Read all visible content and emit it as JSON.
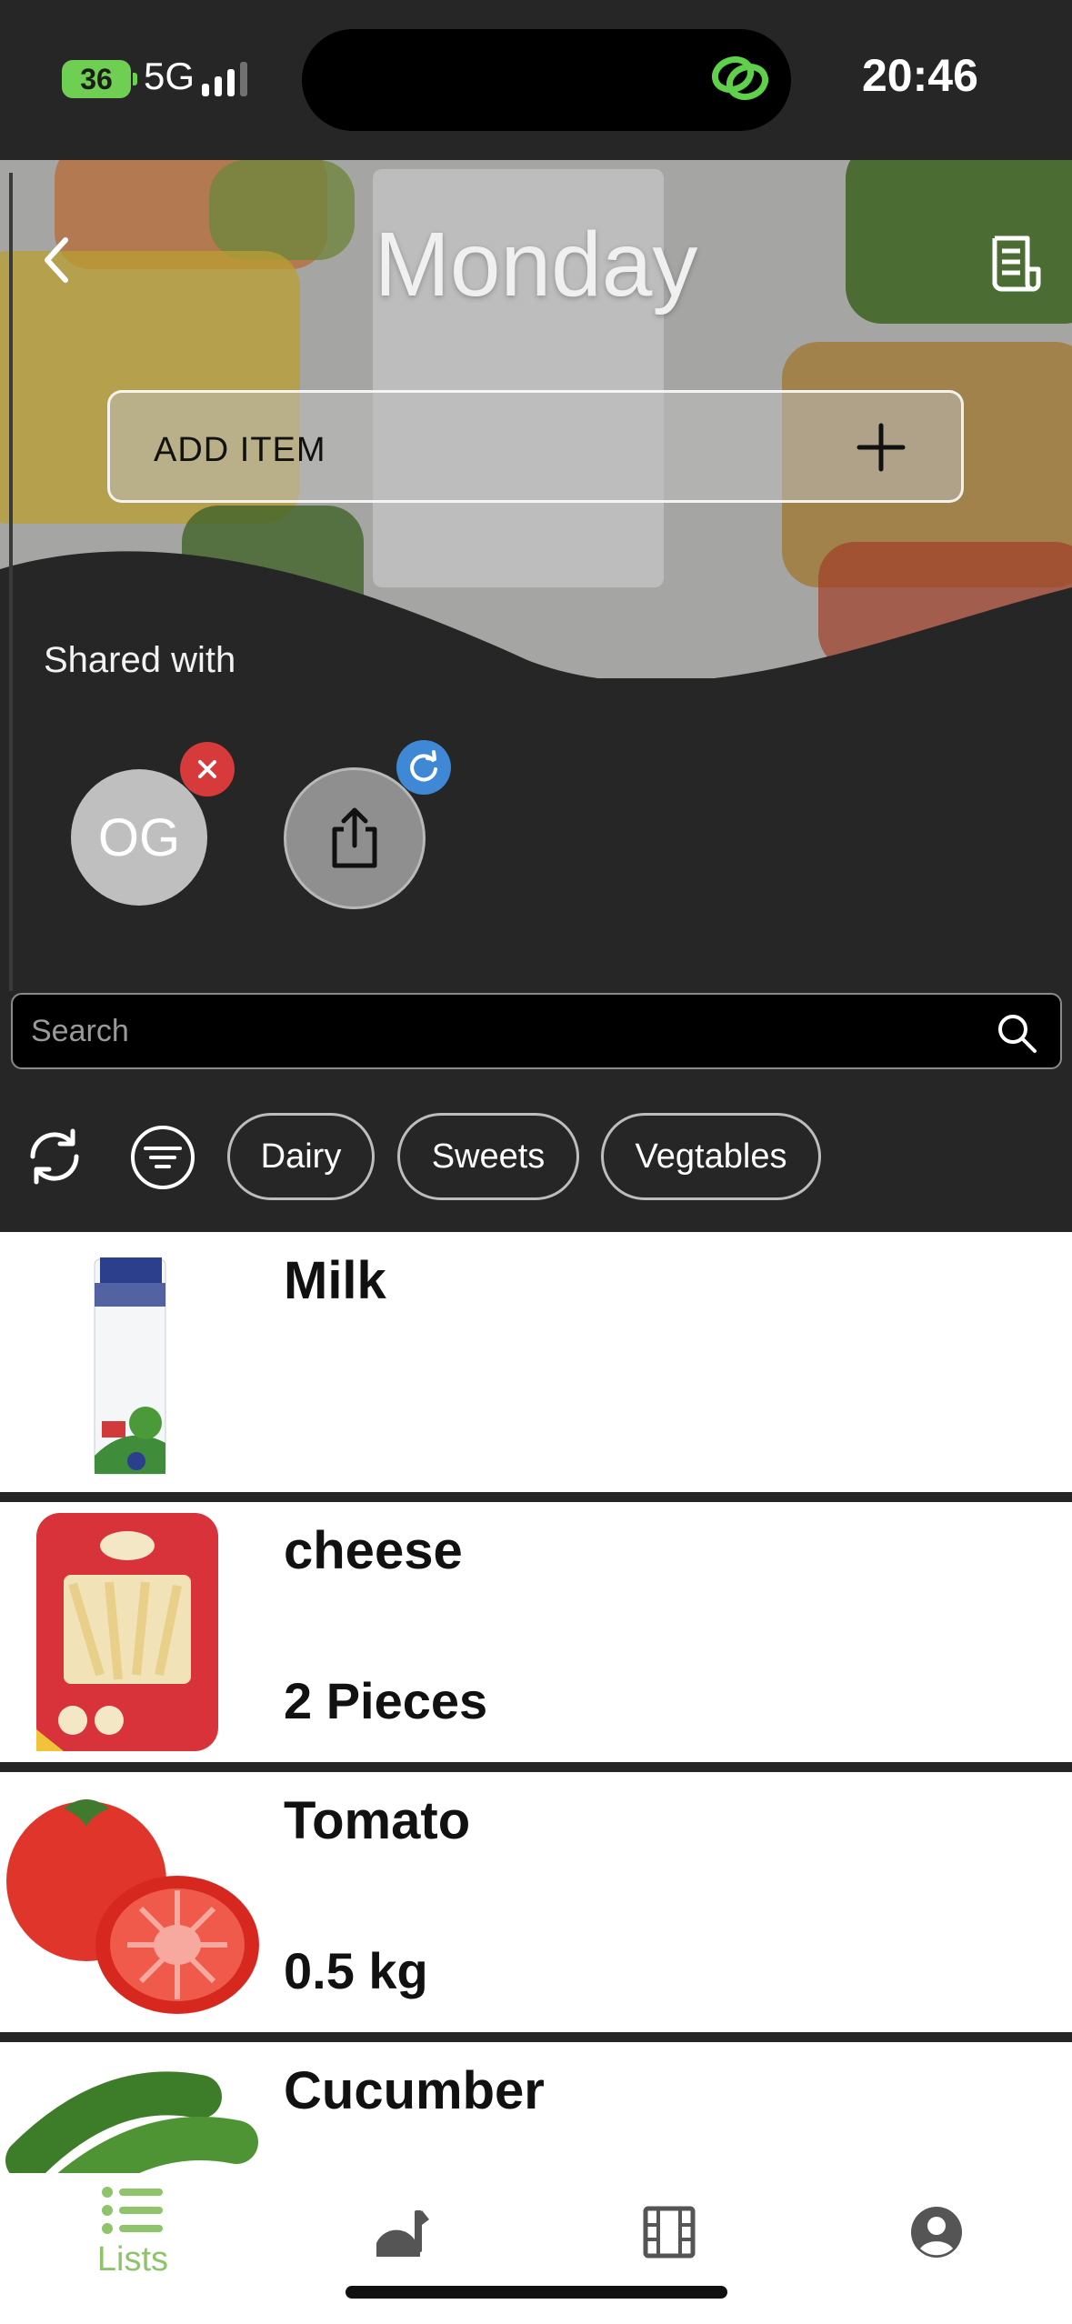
{
  "status_bar": {
    "battery": "36",
    "network": "5G",
    "time": "20:46"
  },
  "header": {
    "title": "Monday",
    "add_item_label": "ADD ITEM"
  },
  "shared": {
    "label": "Shared with",
    "members": [
      {
        "initials": "OG"
      }
    ]
  },
  "search": {
    "placeholder": "Search"
  },
  "filters": {
    "categories": [
      "Dairy",
      "Sweets",
      "Vegtables"
    ]
  },
  "items": [
    {
      "name": "Milk",
      "quantity": ""
    },
    {
      "name": "cheese",
      "quantity": "2 Pieces"
    },
    {
      "name": "Tomato",
      "quantity": "0.5 kg"
    },
    {
      "name": "Cucumber",
      "quantity": ""
    }
  ],
  "tabbar": {
    "tabs": [
      {
        "label": "Lists",
        "active": true
      },
      {
        "label": ""
      },
      {
        "label": ""
      },
      {
        "label": ""
      }
    ]
  },
  "colors": {
    "accent_green": "#8ec46a",
    "background": "#262626",
    "remove_red": "#d63a3a",
    "refresh_blue": "#3f88d6"
  }
}
